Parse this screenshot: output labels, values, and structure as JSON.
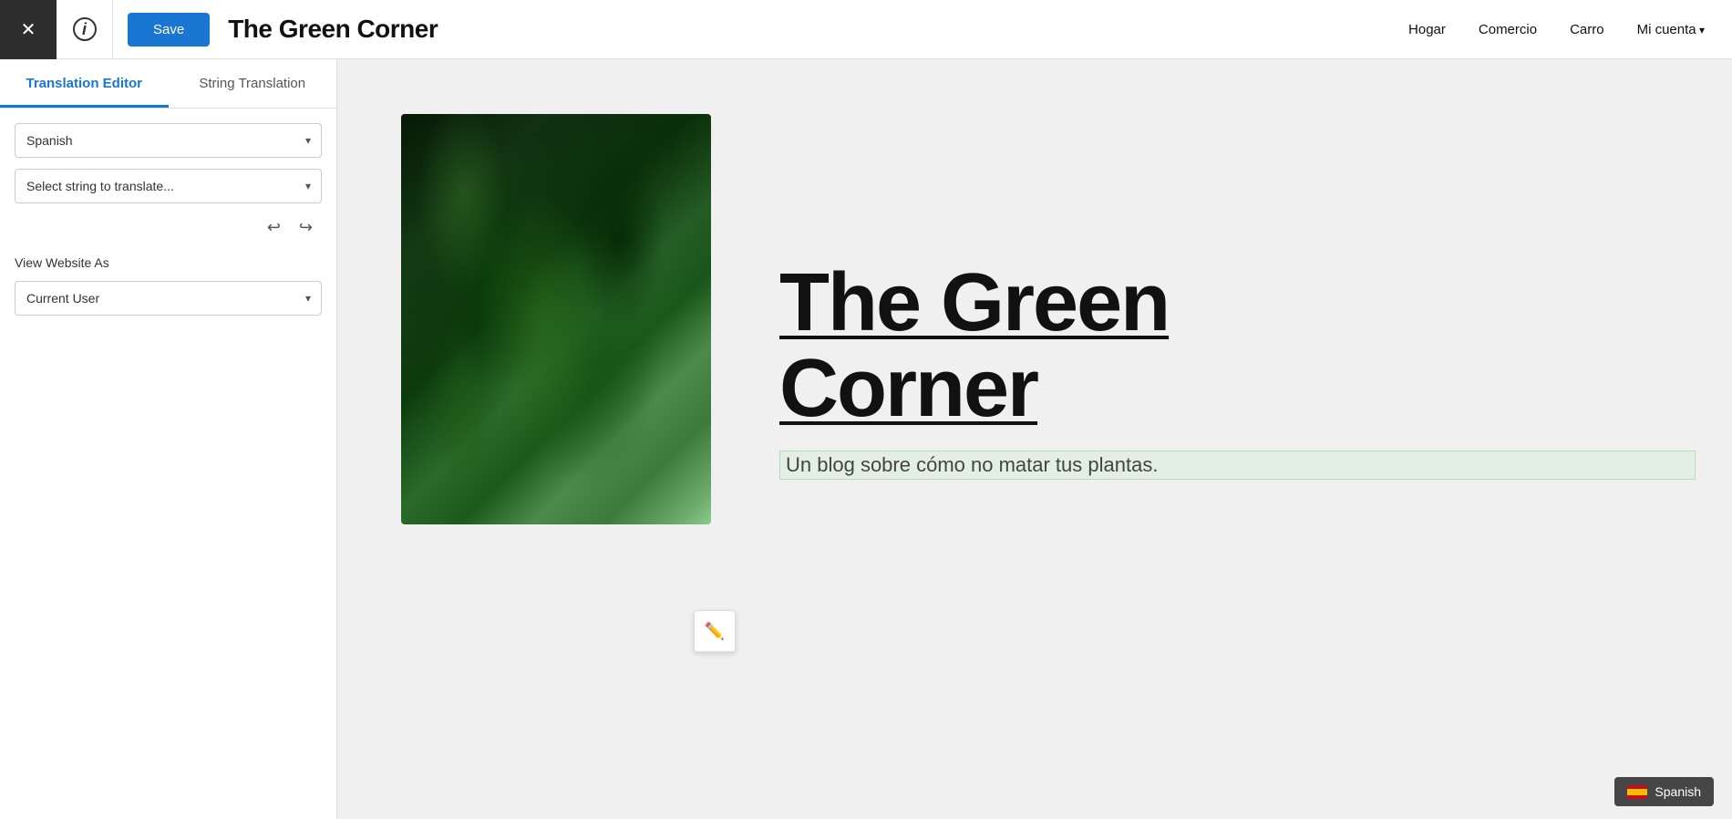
{
  "topbar": {
    "close_icon": "×",
    "info_icon": "i",
    "save_label": "Save",
    "site_title": "The Green Corner"
  },
  "nav": {
    "items": [
      {
        "label": "Hogar",
        "has_arrow": false
      },
      {
        "label": "Comercio",
        "has_arrow": false
      },
      {
        "label": "Carro",
        "has_arrow": false
      },
      {
        "label": "Mi cuenta",
        "has_arrow": true
      }
    ]
  },
  "sidebar": {
    "tab_translation_editor": "Translation Editor",
    "tab_string_translation": "String Translation",
    "language_label": "Spanish",
    "language_placeholder": "Spanish",
    "string_placeholder": "Select string to translate...",
    "view_website_as_label": "View Website As",
    "current_user_label": "Current User"
  },
  "hero": {
    "title_line1": "The Green",
    "title_line2": "Corner",
    "subtitle": "Un blog sobre cómo no matar tus plantas."
  },
  "bottom_badge": {
    "language": "Spanish"
  }
}
